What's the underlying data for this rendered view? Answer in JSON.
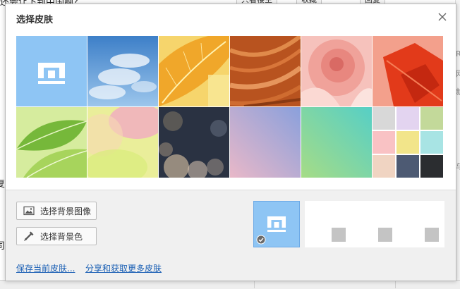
{
  "background": {
    "top_text": "还会让下到中国啊？",
    "buttons": [
      "只看楼主",
      "收藏",
      "回复"
    ],
    "left_chars": [
      "复",
      "司"
    ],
    "right_chars": [
      "R",
      "网",
      "新",
      "与"
    ]
  },
  "dialog": {
    "title": "选择皮肤",
    "close_icon": "close-icon",
    "skins": [
      {
        "name": "maxthon-default",
        "color": "#8ec5f4"
      },
      {
        "name": "blue-sky",
        "color": "#6ea2d8"
      },
      {
        "name": "yellow-leaf",
        "color": "#f1c33c"
      },
      {
        "name": "wood-grain",
        "color": "#b8531f"
      },
      {
        "name": "pink-flower",
        "color": "#f0a29a"
      },
      {
        "name": "red-leaf",
        "color": "#e23a1a"
      },
      {
        "name": "green-leaves",
        "color": "#a7d45c"
      },
      {
        "name": "pastel-watercolor",
        "color": "#e9e68f"
      },
      {
        "name": "bokeh-night",
        "color": "#2a3242"
      },
      {
        "name": "lavender-gradient",
        "color": "#a7a4d6"
      },
      {
        "name": "mint-gradient",
        "color": "#6fd6b0"
      },
      {
        "name": "color-swatches",
        "color": "#c8c8c8"
      }
    ],
    "swatches": [
      "#d8d8d8",
      "#e3d4f0",
      "#c3d99a",
      "#f9c2c4",
      "#f2e58a",
      "#a8e4e4",
      "#f0d4c2",
      "#4d5a73",
      "#2b2d30"
    ],
    "choose_image_label": "选择背景图像",
    "choose_color_label": "选择背景色",
    "save_link": "保存当前皮肤...",
    "share_link": "分享和获取更多皮肤",
    "recent_skins": [
      {
        "name": "maxthon-default",
        "selected": true
      },
      {
        "name": "empty",
        "selected": false
      },
      {
        "name": "empty",
        "selected": false
      },
      {
        "name": "empty",
        "selected": false
      }
    ]
  }
}
